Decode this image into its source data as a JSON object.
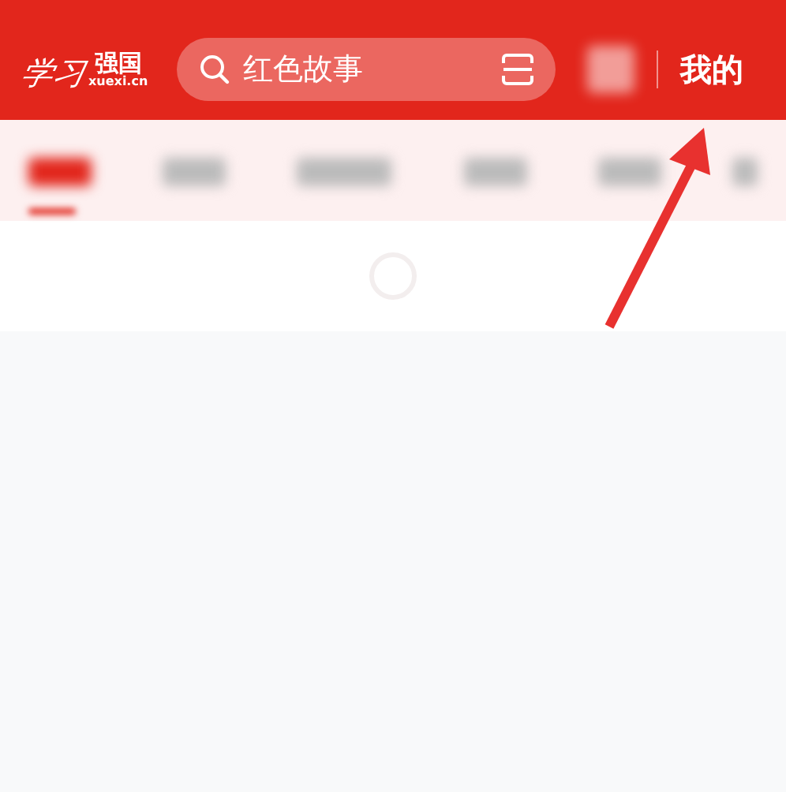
{
  "header": {
    "logo": {
      "script": "学习",
      "name": "强国",
      "domain": "xuexi.cn"
    },
    "search": {
      "placeholder": "红色故事"
    },
    "profile_link": "我的"
  },
  "tabs": [
    {
      "selected": true
    },
    {
      "selected": false
    },
    {
      "selected": false
    },
    {
      "selected": false
    },
    {
      "selected": false
    },
    {
      "selected": false
    }
  ]
}
